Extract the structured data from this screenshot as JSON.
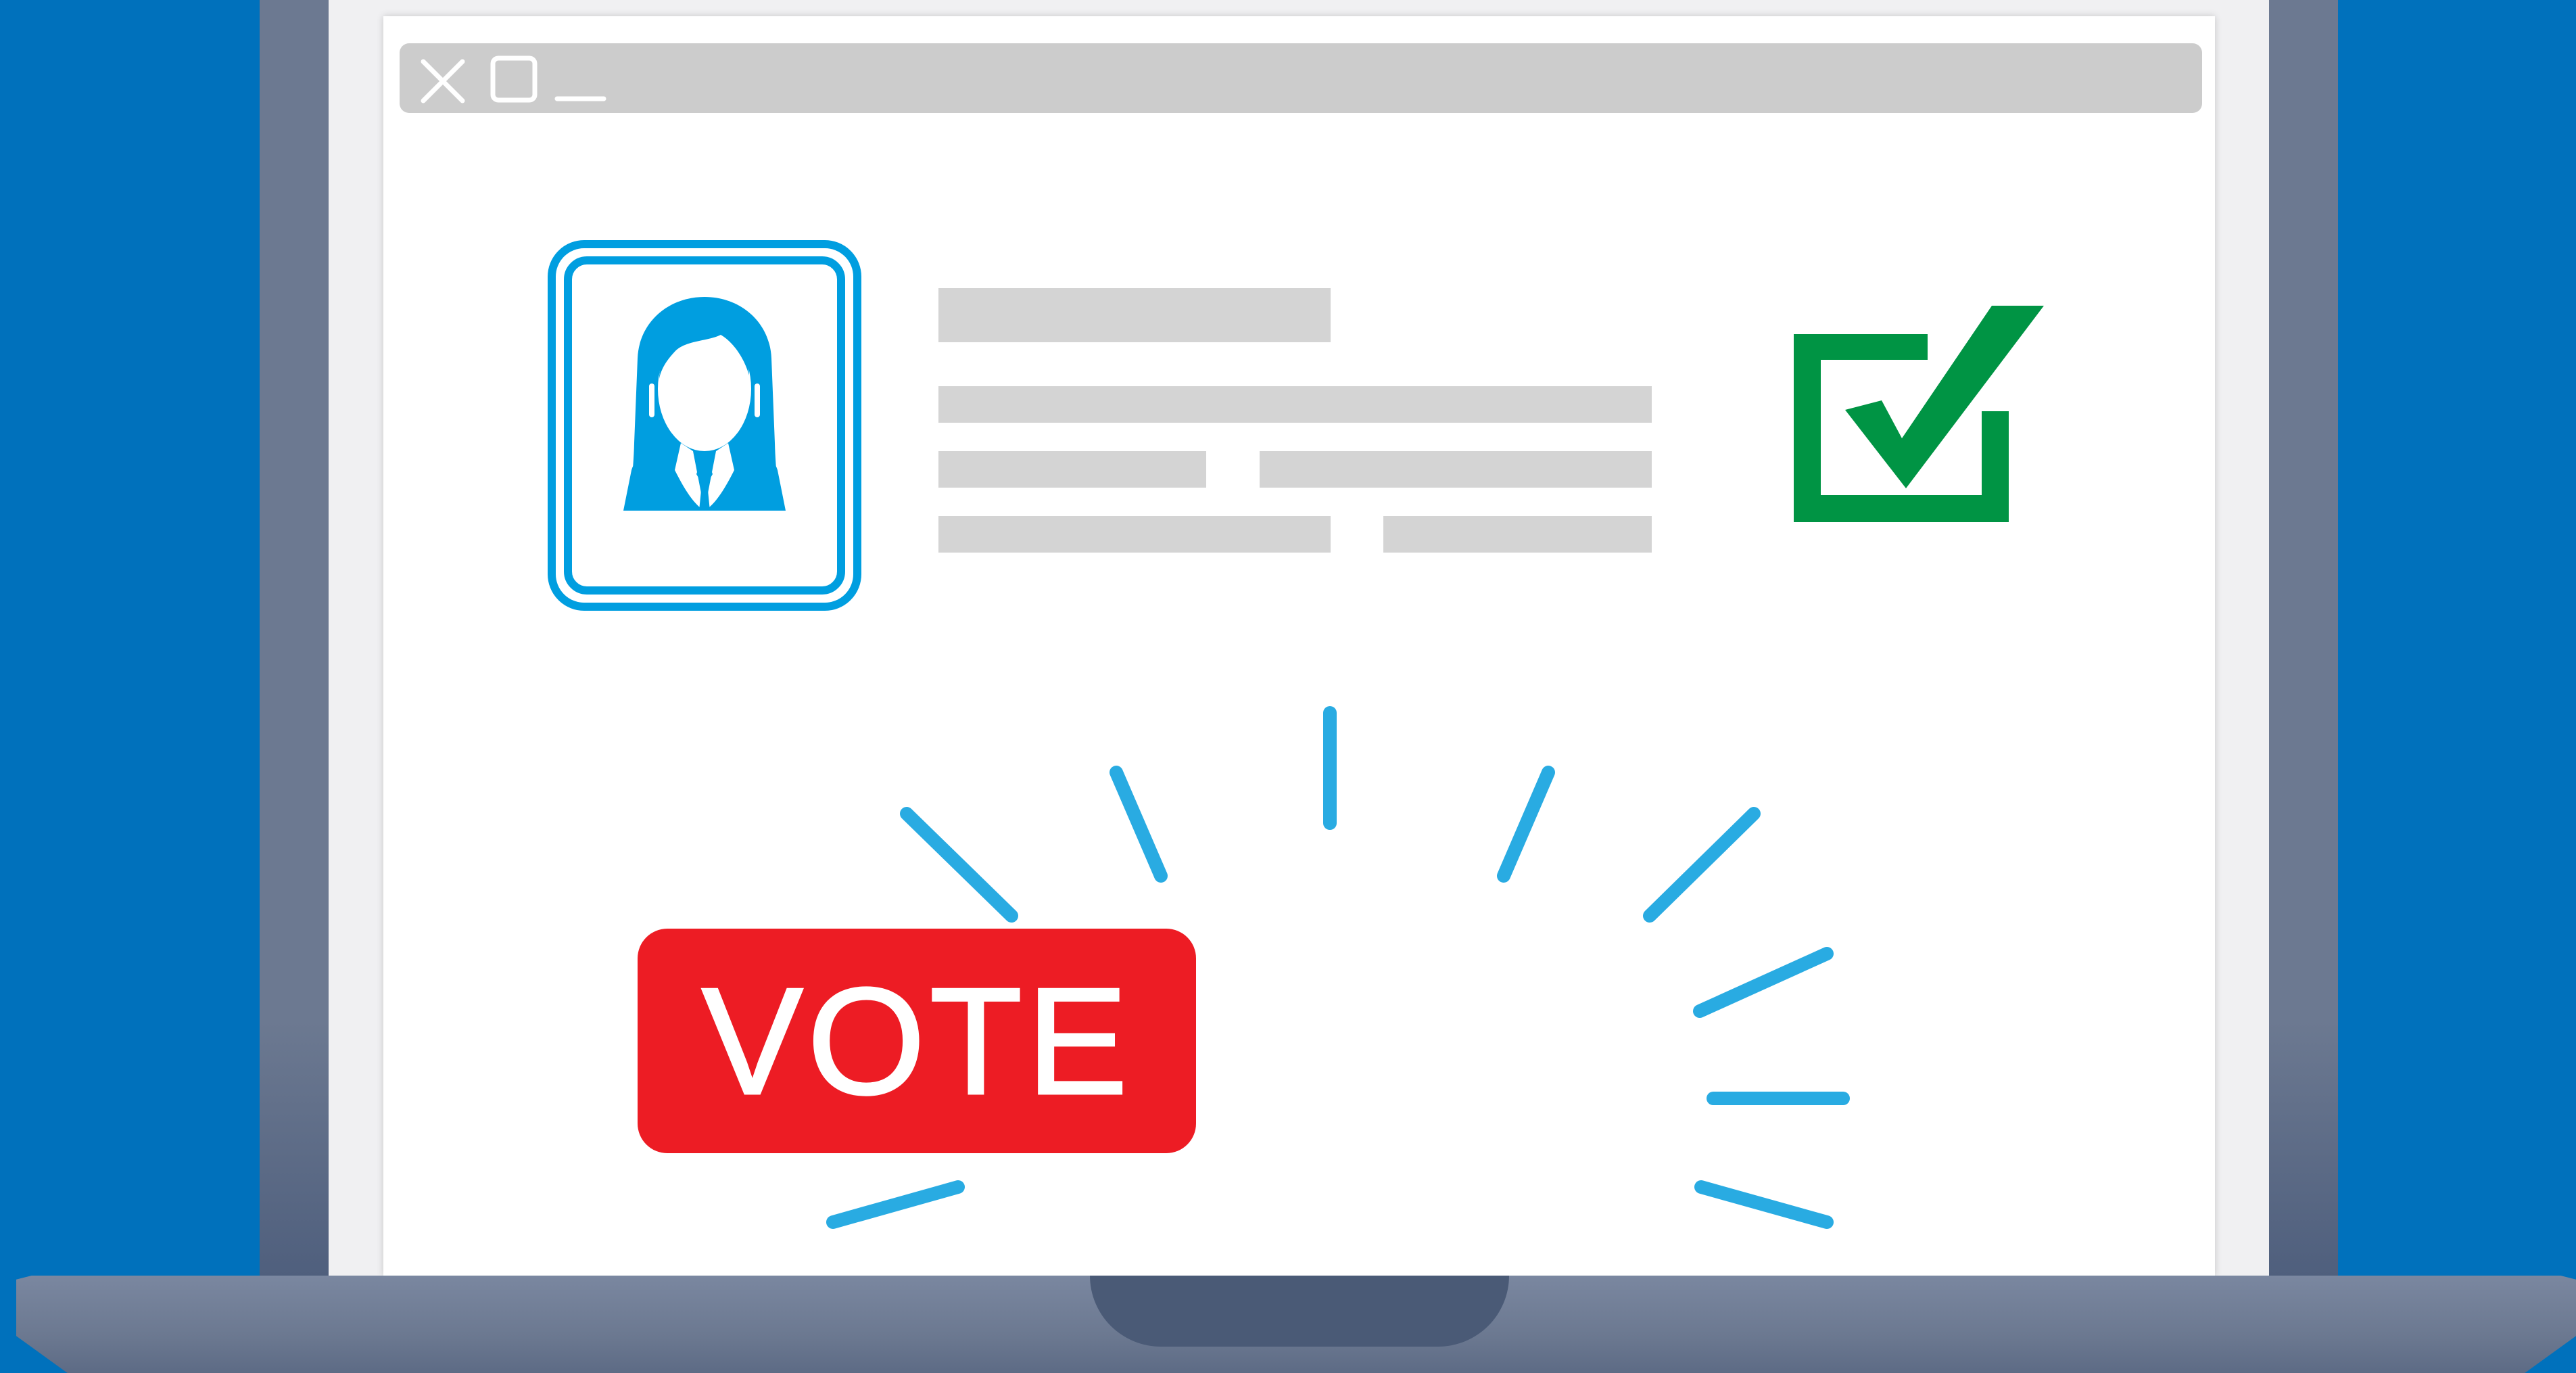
{
  "window_controls": {
    "close_icon": "close-icon",
    "maximize_icon": "maximize-icon",
    "minimize_icon": "minimize-icon"
  },
  "candidate": {
    "avatar_icon": "female-candidate-avatar-icon"
  },
  "checkbox": {
    "icon": "checked-checkbox-icon",
    "checked": true
  },
  "vote_button": {
    "label": "VOTE"
  },
  "colors": {
    "background": "#0071bc",
    "laptop": "#6c7991",
    "accent_blue": "#009ee0",
    "check_green": "#009444",
    "vote_red": "#ed1c24",
    "placeholder_gray": "#d4d4d4",
    "titlebar_gray": "#cccccc",
    "burst_blue": "#29abe2"
  }
}
